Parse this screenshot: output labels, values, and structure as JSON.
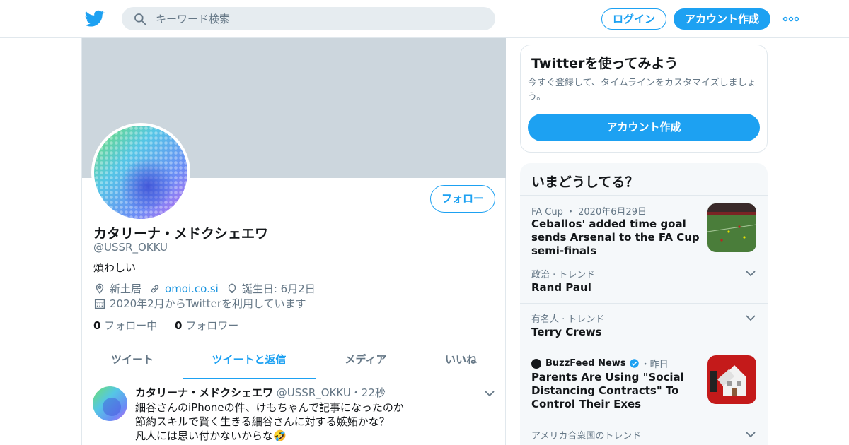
{
  "header": {
    "search_placeholder": "キーワード検索",
    "login_label": "ログイン",
    "signup_label": "アカウント作成",
    "brand_color": "#1da1f2"
  },
  "profile": {
    "name": "カタリーナ・メドクシェエワ",
    "handle": "@USSR_OKKU",
    "bio": "煩わしい",
    "location": "新土居",
    "website": "omoi.co.si",
    "birthday": "誕生日: 6月2日",
    "joined": "2020年2月からTwitterを利用しています",
    "following_count": "0",
    "following_label": "フォロー中",
    "followers_count": "0",
    "followers_label": "フォロワー",
    "follow_button": "フォロー"
  },
  "tabs": [
    {
      "label": "ツイート",
      "active": false
    },
    {
      "label": "ツイートと返信",
      "active": true
    },
    {
      "label": "メディア",
      "active": false
    },
    {
      "label": "いいね",
      "active": false
    }
  ],
  "tweet": {
    "name": "カタリーナ・メドクシェエワ",
    "handle": "@USSR_OKKU",
    "time": "・22秒",
    "lines": [
      "細谷さんのiPhoneの件、けもちゃんで記事になったのか",
      "節約スキルで賢く生きる細谷さんに対する嫉妬かな？",
      "凡人には思い付かないからな🤣"
    ]
  },
  "signup_card": {
    "title": "Twitterを使ってみよう",
    "description": "今すぐ登録して、タイムラインをカスタマイズしましょう。",
    "button": "アカウント作成"
  },
  "trends": {
    "title": "いまどうしてる？",
    "items": [
      {
        "category": "FA Cup ・ 2020年6月29日",
        "title": "Ceballos' added time goal sends Arsenal to the FA Cup semi-finals"
      },
      {
        "category": "政治 · トレンド",
        "title": "Rand Paul"
      },
      {
        "category": "有名人 · トレンド",
        "title": "Terry Crews"
      },
      {
        "source": "BuzzFeed News",
        "time": "・昨日",
        "title": "Parents Are Using \"Social Distancing Contracts\" To Control Their Exes"
      },
      {
        "category": "アメリカ合衆国のトレンド",
        "title": ""
      }
    ]
  }
}
